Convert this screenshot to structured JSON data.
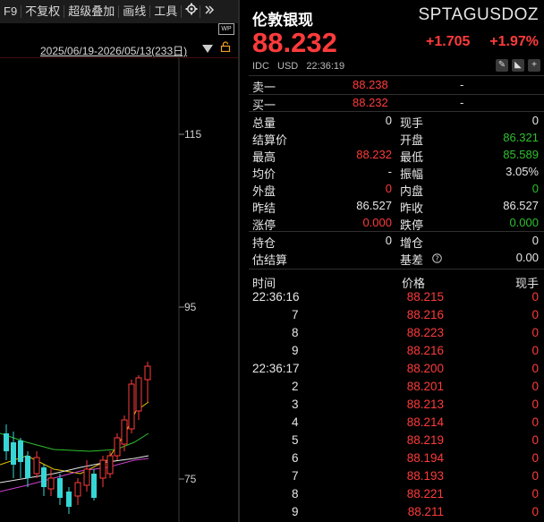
{
  "toolbar": {
    "items": [
      "F9",
      "不复权",
      "超级叠加",
      "画线",
      "工具"
    ],
    "gear_icon": "gear-icon",
    "more_icon": "double-chevron-right-icon"
  },
  "chart": {
    "range_label": "2025/06/19-2026/05/13(233日)",
    "wp_badge": "WP",
    "price_ticks": [
      "115",
      "95",
      "75"
    ]
  },
  "chart_data": {
    "type": "candlestick",
    "y_ticks": [
      115,
      95,
      75
    ],
    "colors": {
      "up": "#ff3b3b",
      "down": "#36d6d6",
      "ma1": "#e6e6e6",
      "ma2": "#e6c700",
      "ma3": "#d040d0",
      "ma4": "#2ec02e"
    }
  },
  "quote": {
    "name": "伦敦银现",
    "code": "SPTAGUSDOZ",
    "price": "88.232",
    "change": "+1.705",
    "change_pct": "+1.97%",
    "market": "IDC",
    "currency": "USD",
    "time": "22:36:19"
  },
  "book": {
    "sell_label": "卖一",
    "sell_price": "88.238",
    "sell_vol": "-",
    "buy_label": "买一",
    "buy_price": "88.232",
    "buy_vol": "-"
  },
  "stats": {
    "zongliang_label": "总量",
    "zongliang": "0",
    "xianshou_label": "现手",
    "xianshou": "0",
    "jiesuanjia_label": "结算价",
    "jiesuanjia": "",
    "kaipan_label": "开盘",
    "kaipan": "86.321",
    "zuigao_label": "最高",
    "zuigao": "88.232",
    "zuidi_label": "最低",
    "zuidi": "85.589",
    "junjia_label": "均价",
    "junjia": "-",
    "zhenfu_label": "振幅",
    "zhenfu": "3.05%",
    "waipan_label": "外盘",
    "waipan": "0",
    "neipan_label": "内盘",
    "neipan": "0",
    "zuojie_label": "昨结",
    "zuojie": "86.527",
    "zuoshou_label": "昨收",
    "zuoshou": "86.527",
    "zhangting_label": "涨停",
    "zhangting": "0.000",
    "dieting_label": "跌停",
    "dieting": "0.000",
    "chicang_label": "持仓",
    "chicang": "0",
    "zengcang_label": "增仓",
    "zengcang": "0",
    "gujiesuan_label": "估结算",
    "gujiesuan": "",
    "jicha_label": "基差",
    "jicha": "0.00"
  },
  "trades": {
    "head_time": "时间",
    "head_price": "价格",
    "head_vol": "现手",
    "rows": [
      {
        "time": "22:36:16",
        "price": "88.215",
        "vol": "0"
      },
      {
        "time": "7",
        "price": "88.216",
        "vol": "0"
      },
      {
        "time": "8",
        "price": "88.223",
        "vol": "0"
      },
      {
        "time": "9",
        "price": "88.216",
        "vol": "0"
      },
      {
        "time": "22:36:17",
        "price": "88.200",
        "vol": "0"
      },
      {
        "time": "2",
        "price": "88.201",
        "vol": "0"
      },
      {
        "time": "3",
        "price": "88.213",
        "vol": "0"
      },
      {
        "time": "4",
        "price": "88.214",
        "vol": "0"
      },
      {
        "time": "5",
        "price": "88.219",
        "vol": "0"
      },
      {
        "time": "6",
        "price": "88.194",
        "vol": "0"
      },
      {
        "time": "7",
        "price": "88.193",
        "vol": "0"
      },
      {
        "time": "8",
        "price": "88.221",
        "vol": "0"
      },
      {
        "time": "9",
        "price": "88.211",
        "vol": "0"
      }
    ]
  }
}
